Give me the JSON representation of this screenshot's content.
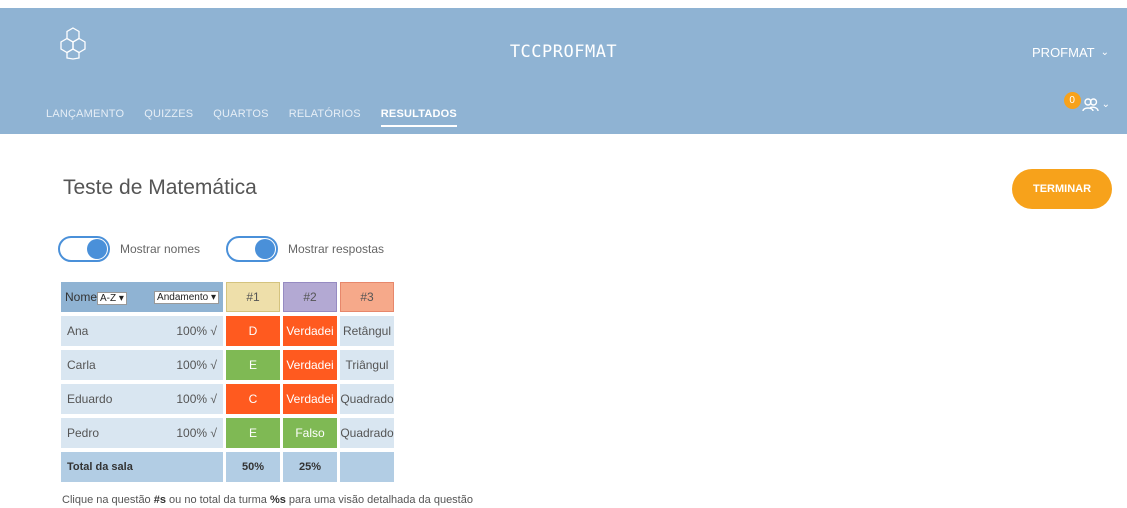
{
  "header": {
    "app_title": "TCCPROFMAT",
    "user_label": "PROFMAT",
    "notification_count": "0",
    "nav": [
      "LANÇAMENTO",
      "QUIZZES",
      "QUARTOS",
      "RELATÓRIOS",
      "RESULTADOS"
    ],
    "active_tab": "RESULTADOS"
  },
  "page": {
    "title": "Teste de Matemática",
    "finish_label": "TERMINAR",
    "toggle_names_label": "Mostrar nomes",
    "toggle_answers_label": "Mostrar respostas"
  },
  "table": {
    "name_header": "Nome",
    "sort_option": "A-Z",
    "progress_option": "Andamento",
    "questions": [
      "#1",
      "#2",
      "#3"
    ],
    "rows": [
      {
        "name": "Ana",
        "progress": "100% √",
        "answers": [
          "D",
          "Verdadei",
          "Retângul"
        ]
      },
      {
        "name": "Carla",
        "progress": "100% √",
        "answers": [
          "E",
          "Verdadei",
          "Triângul"
        ]
      },
      {
        "name": "Eduardo",
        "progress": "100% √",
        "answers": [
          "C",
          "Verdadei",
          "Quadrado"
        ]
      },
      {
        "name": "Pedro",
        "progress": "100% √",
        "answers": [
          "E",
          "Falso",
          "Quadrado"
        ]
      }
    ],
    "answer_status": [
      [
        "red",
        "red",
        "plain"
      ],
      [
        "green",
        "red",
        "plain"
      ],
      [
        "red",
        "red",
        "plain"
      ],
      [
        "green",
        "green",
        "plain"
      ]
    ],
    "total_label": "Total da sala",
    "totals": [
      "50%",
      "25%",
      ""
    ]
  },
  "hint": {
    "p1": "Clique na questão ",
    "b1": "#s",
    "p2": " ou no total da turma ",
    "b2": "%s",
    "p3": " para uma visão detalhada da questão"
  },
  "colors": {
    "header_bg": "#8fb3d3",
    "accent": "#f7a21b",
    "wrong": "#ff5a1f",
    "correct": "#7fb954"
  }
}
